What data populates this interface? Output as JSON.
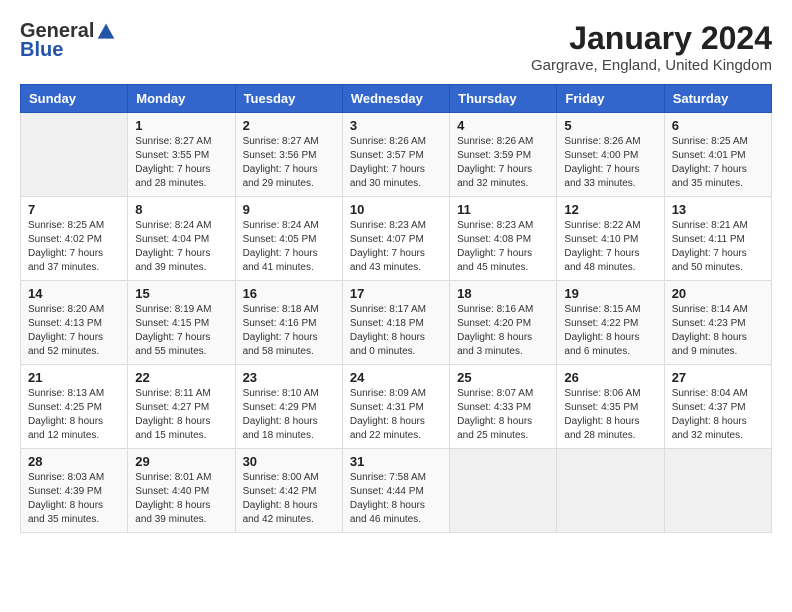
{
  "logo": {
    "general": "General",
    "blue": "Blue"
  },
  "title": "January 2024",
  "location": "Gargrave, England, United Kingdom",
  "headers": [
    "Sunday",
    "Monday",
    "Tuesday",
    "Wednesday",
    "Thursday",
    "Friday",
    "Saturday"
  ],
  "weeks": [
    [
      {
        "num": "",
        "info": ""
      },
      {
        "num": "1",
        "info": "Sunrise: 8:27 AM\nSunset: 3:55 PM\nDaylight: 7 hours\nand 28 minutes."
      },
      {
        "num": "2",
        "info": "Sunrise: 8:27 AM\nSunset: 3:56 PM\nDaylight: 7 hours\nand 29 minutes."
      },
      {
        "num": "3",
        "info": "Sunrise: 8:26 AM\nSunset: 3:57 PM\nDaylight: 7 hours\nand 30 minutes."
      },
      {
        "num": "4",
        "info": "Sunrise: 8:26 AM\nSunset: 3:59 PM\nDaylight: 7 hours\nand 32 minutes."
      },
      {
        "num": "5",
        "info": "Sunrise: 8:26 AM\nSunset: 4:00 PM\nDaylight: 7 hours\nand 33 minutes."
      },
      {
        "num": "6",
        "info": "Sunrise: 8:25 AM\nSunset: 4:01 PM\nDaylight: 7 hours\nand 35 minutes."
      }
    ],
    [
      {
        "num": "7",
        "info": "Sunrise: 8:25 AM\nSunset: 4:02 PM\nDaylight: 7 hours\nand 37 minutes."
      },
      {
        "num": "8",
        "info": "Sunrise: 8:24 AM\nSunset: 4:04 PM\nDaylight: 7 hours\nand 39 minutes."
      },
      {
        "num": "9",
        "info": "Sunrise: 8:24 AM\nSunset: 4:05 PM\nDaylight: 7 hours\nand 41 minutes."
      },
      {
        "num": "10",
        "info": "Sunrise: 8:23 AM\nSunset: 4:07 PM\nDaylight: 7 hours\nand 43 minutes."
      },
      {
        "num": "11",
        "info": "Sunrise: 8:23 AM\nSunset: 4:08 PM\nDaylight: 7 hours\nand 45 minutes."
      },
      {
        "num": "12",
        "info": "Sunrise: 8:22 AM\nSunset: 4:10 PM\nDaylight: 7 hours\nand 48 minutes."
      },
      {
        "num": "13",
        "info": "Sunrise: 8:21 AM\nSunset: 4:11 PM\nDaylight: 7 hours\nand 50 minutes."
      }
    ],
    [
      {
        "num": "14",
        "info": "Sunrise: 8:20 AM\nSunset: 4:13 PM\nDaylight: 7 hours\nand 52 minutes."
      },
      {
        "num": "15",
        "info": "Sunrise: 8:19 AM\nSunset: 4:15 PM\nDaylight: 7 hours\nand 55 minutes."
      },
      {
        "num": "16",
        "info": "Sunrise: 8:18 AM\nSunset: 4:16 PM\nDaylight: 7 hours\nand 58 minutes."
      },
      {
        "num": "17",
        "info": "Sunrise: 8:17 AM\nSunset: 4:18 PM\nDaylight: 8 hours\nand 0 minutes."
      },
      {
        "num": "18",
        "info": "Sunrise: 8:16 AM\nSunset: 4:20 PM\nDaylight: 8 hours\nand 3 minutes."
      },
      {
        "num": "19",
        "info": "Sunrise: 8:15 AM\nSunset: 4:22 PM\nDaylight: 8 hours\nand 6 minutes."
      },
      {
        "num": "20",
        "info": "Sunrise: 8:14 AM\nSunset: 4:23 PM\nDaylight: 8 hours\nand 9 minutes."
      }
    ],
    [
      {
        "num": "21",
        "info": "Sunrise: 8:13 AM\nSunset: 4:25 PM\nDaylight: 8 hours\nand 12 minutes."
      },
      {
        "num": "22",
        "info": "Sunrise: 8:11 AM\nSunset: 4:27 PM\nDaylight: 8 hours\nand 15 minutes."
      },
      {
        "num": "23",
        "info": "Sunrise: 8:10 AM\nSunset: 4:29 PM\nDaylight: 8 hours\nand 18 minutes."
      },
      {
        "num": "24",
        "info": "Sunrise: 8:09 AM\nSunset: 4:31 PM\nDaylight: 8 hours\nand 22 minutes."
      },
      {
        "num": "25",
        "info": "Sunrise: 8:07 AM\nSunset: 4:33 PM\nDaylight: 8 hours\nand 25 minutes."
      },
      {
        "num": "26",
        "info": "Sunrise: 8:06 AM\nSunset: 4:35 PM\nDaylight: 8 hours\nand 28 minutes."
      },
      {
        "num": "27",
        "info": "Sunrise: 8:04 AM\nSunset: 4:37 PM\nDaylight: 8 hours\nand 32 minutes."
      }
    ],
    [
      {
        "num": "28",
        "info": "Sunrise: 8:03 AM\nSunset: 4:39 PM\nDaylight: 8 hours\nand 35 minutes."
      },
      {
        "num": "29",
        "info": "Sunrise: 8:01 AM\nSunset: 4:40 PM\nDaylight: 8 hours\nand 39 minutes."
      },
      {
        "num": "30",
        "info": "Sunrise: 8:00 AM\nSunset: 4:42 PM\nDaylight: 8 hours\nand 42 minutes."
      },
      {
        "num": "31",
        "info": "Sunrise: 7:58 AM\nSunset: 4:44 PM\nDaylight: 8 hours\nand 46 minutes."
      },
      {
        "num": "",
        "info": ""
      },
      {
        "num": "",
        "info": ""
      },
      {
        "num": "",
        "info": ""
      }
    ]
  ]
}
